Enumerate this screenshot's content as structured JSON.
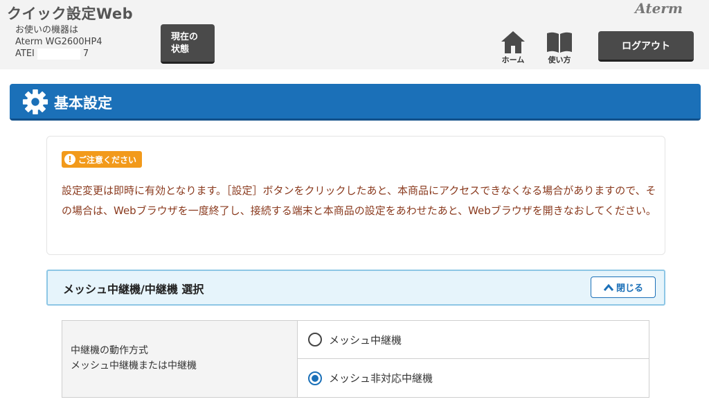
{
  "header": {
    "app_title": "クイック設定Web",
    "brand": "Aterm",
    "device_label": "お使いの機器は",
    "device_model": "Aterm WG2600HP4",
    "device_id_prefix": "ATEI",
    "device_id_suffix": "7",
    "status_button": "現在の\n状態",
    "nav_home": "ホーム",
    "nav_help": "使い方",
    "logout_button": "ログアウト"
  },
  "banner": {
    "title": "基本設定",
    "icon": "gear-icon",
    "color": "#1b70b8"
  },
  "notice": {
    "badge": "ご注意ください",
    "text": "設定変更は即時に有効となります。［設定］ボタンをクリックしたあと、本商品にアクセスできなくなる場合がありますので、その場合は、Webブラウザを一度終了し、接続する端末と本商品の設定をあわせたあと、Webブラウザを開きなおしてください。",
    "badge_color": "#f29a1b",
    "text_color": "#8a3a1e"
  },
  "panel": {
    "title": "メッシュ中継機/中継機 選択",
    "close_button": "閉じる"
  },
  "settings": {
    "label_line1": "中継機の動作方式",
    "label_line2": "メッシュ中継機または中継機",
    "options": [
      {
        "label": "メッシュ中継機",
        "selected": false
      },
      {
        "label": "メッシュ非対応中継機",
        "selected": true
      }
    ]
  }
}
